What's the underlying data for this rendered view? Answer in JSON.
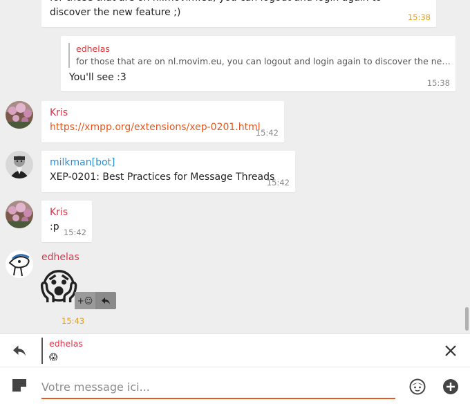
{
  "colors": {
    "accent": "#e8571e",
    "author_red": "#d9334a",
    "author_blue": "#2a8fd6",
    "time_orange": "#e0a020",
    "background": "#eeeeee"
  },
  "messages": [
    {
      "text": "for those that are on nl.movim.eu, you can logout and login again to discover the new feature ;)",
      "time": "15:38"
    },
    {
      "quote_author": "edhelas",
      "quote_text": "for those that are on nl.movim.eu, you can logout and login again to discover the new fe…",
      "text": "You'll see :3",
      "time": "15:38"
    },
    {
      "author": "Kris",
      "link": "https://xmpp.org/extensions/xep-0201.html",
      "time": "15:42"
    },
    {
      "author": "milkman[bot]",
      "text": "XEP-0201: Best Practices for Message Threads",
      "time": "15:42"
    },
    {
      "author": "Kris",
      "text": ":p",
      "time": "15:42"
    },
    {
      "author": "edhelas",
      "emoji": "😱",
      "time": "15:43",
      "actions": {
        "react": "+☺",
        "reply_icon": "reply-icon"
      }
    }
  ],
  "reply_preview": {
    "author": "edhelas",
    "text": "😱"
  },
  "composer": {
    "placeholder": "Votre message ici..."
  }
}
